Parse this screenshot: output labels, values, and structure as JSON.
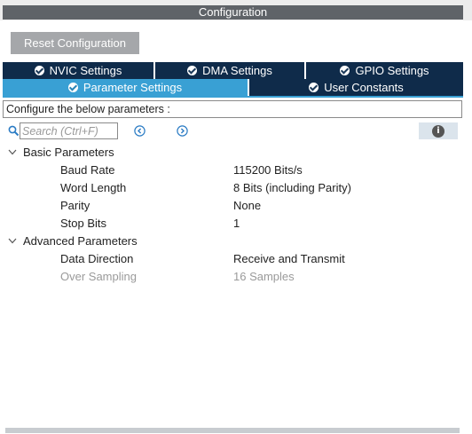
{
  "window": {
    "title": "Configuration"
  },
  "toolbar": {
    "reset_label": "Reset Configuration"
  },
  "tabs": {
    "row1": [
      {
        "label": "NVIC Settings"
      },
      {
        "label": "DMA Settings"
      },
      {
        "label": "GPIO Settings"
      }
    ],
    "row2": [
      {
        "label": "Parameter Settings",
        "active": true
      },
      {
        "label": "User Constants"
      }
    ]
  },
  "description": "Configure the below parameters :",
  "search": {
    "placeholder": "Search (Ctrl+F)",
    "value": ""
  },
  "groups": [
    {
      "label": "Basic Parameters",
      "expanded": true,
      "params": [
        {
          "name": "Baud Rate",
          "value": "115200 Bits/s"
        },
        {
          "name": "Word Length",
          "value": "8 Bits (including Parity)"
        },
        {
          "name": "Parity",
          "value": "None"
        },
        {
          "name": "Stop Bits",
          "value": "1"
        }
      ]
    },
    {
      "label": "Advanced Parameters",
      "expanded": true,
      "params": [
        {
          "name": "Data Direction",
          "value": "Receive and Transmit"
        },
        {
          "name": "Over Sampling",
          "value": "16 Samples",
          "disabled": true
        }
      ]
    }
  ],
  "colors": {
    "tab_dark": "#0f2b4a",
    "tab_active": "#39a0d4",
    "title_bar": "#5f6368",
    "button": "#a5a7aa"
  }
}
